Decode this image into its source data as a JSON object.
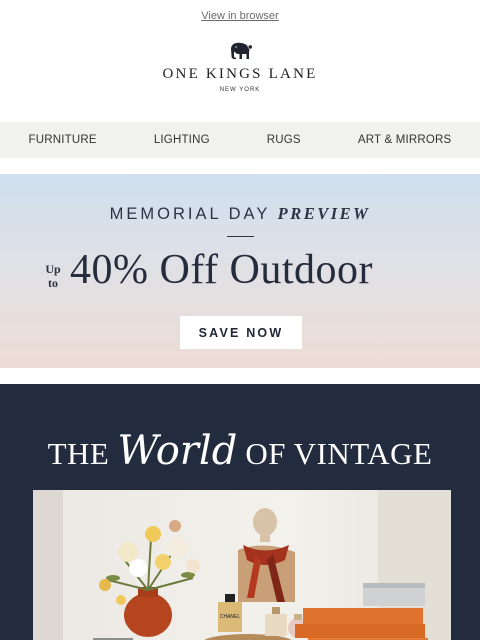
{
  "header": {
    "view_in_browser": "View in browser",
    "brand_name": "ONE KINGS LANE",
    "brand_sub": "NEW YORK",
    "logo_icon": "elephant-icon"
  },
  "nav": {
    "items": [
      {
        "label": "FURNITURE"
      },
      {
        "label": "LIGHTING"
      },
      {
        "label": "RUGS"
      },
      {
        "label": "ART & MIRRORS"
      }
    ]
  },
  "hero": {
    "eyebrow_plain": "MEMORIAL DAY ",
    "eyebrow_em": "PREVIEW",
    "upto_line1": "Up",
    "upto_line2": "to",
    "headline": "40% Off Outdoor",
    "cta": "SAVE NOW"
  },
  "vintage": {
    "title_pre": "THE",
    "title_script": "World",
    "title_post": "OF VINTAGE",
    "perfume_label": "CHANEL"
  },
  "colors": {
    "navy": "#232c3e",
    "nav_bg": "#f1f1f0",
    "accent_orange": "#e0742e"
  }
}
